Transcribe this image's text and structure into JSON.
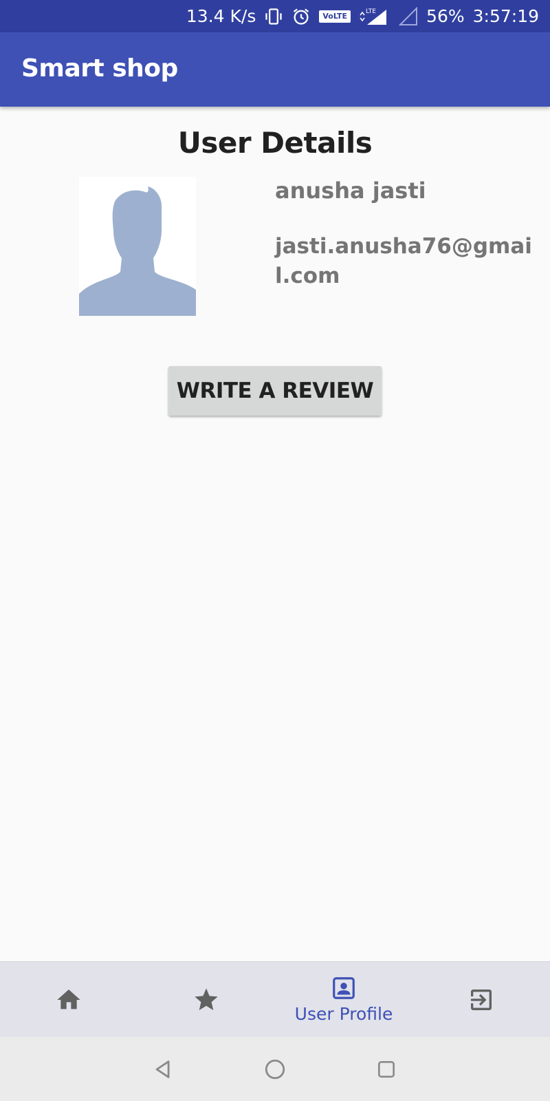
{
  "status_bar": {
    "net_speed": "13.4 K/s",
    "volte_label": "VoLTE",
    "lte_label": "LTE",
    "battery": "56%",
    "time": "3:57:19",
    "icons": [
      "vibrate-icon",
      "alarm-icon",
      "volte-icon",
      "signal-lte-icon",
      "signal-empty-icon"
    ]
  },
  "app_bar": {
    "title": "Smart shop",
    "color": "#3f51b5"
  },
  "main": {
    "page_title": "User Details",
    "user": {
      "name": "anusha jasti",
      "email": "jasti.anusha76@gmail.com",
      "avatar_icon": "user-silhouette-icon"
    },
    "review_button_label": "WRITE A REVIEW"
  },
  "bottom_nav": {
    "items": [
      {
        "icon": "home-icon",
        "label": "",
        "active": false
      },
      {
        "icon": "star-icon",
        "label": "",
        "active": false
      },
      {
        "icon": "user-profile-icon",
        "label": "User Profile",
        "active": true
      },
      {
        "icon": "exit-icon",
        "label": "",
        "active": false
      }
    ],
    "active_color": "#3f51b5",
    "inactive_color": "#616161"
  },
  "system_nav": {
    "icons": [
      "back-icon",
      "home-circle-icon",
      "recents-icon"
    ]
  }
}
